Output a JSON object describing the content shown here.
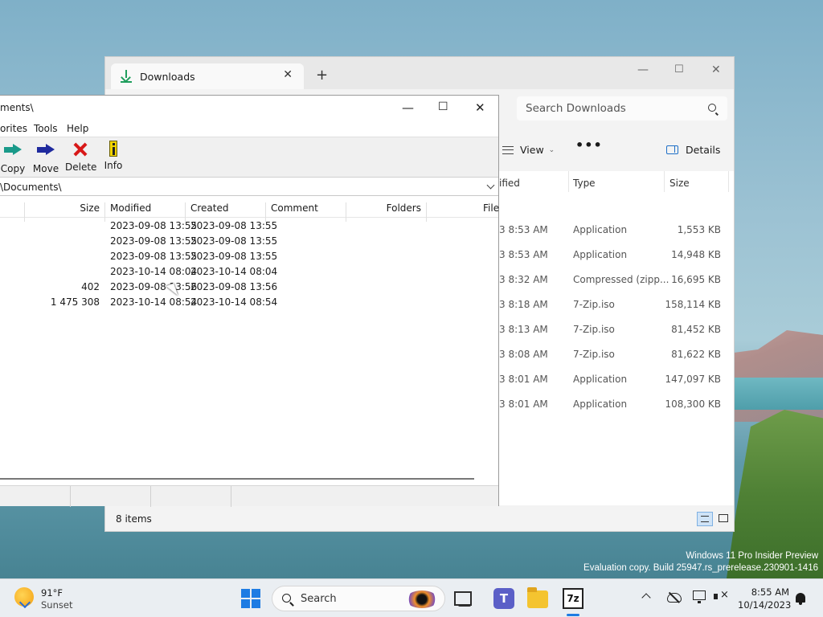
{
  "desktop": {
    "watermark_line1": "Windows 11 Pro Insider Preview",
    "watermark_line2": "Evaluation copy. Build 25947.rs_prerelease.230901-1416"
  },
  "explorer": {
    "tab_title": "Downloads",
    "search_placeholder": "Search Downloads",
    "view_label": "View",
    "more_label": "•••",
    "details_label": "Details",
    "columns": {
      "modified": "ified",
      "type": "Type",
      "size": "Size"
    },
    "rows": [
      {
        "modified": "3 8:53 AM",
        "type": "Application",
        "size": "1,553 KB"
      },
      {
        "modified": "3 8:53 AM",
        "type": "Application",
        "size": "14,948 KB"
      },
      {
        "modified": "3 8:32 AM",
        "type": "Compressed (zipp...",
        "size": "16,695 KB"
      },
      {
        "modified": "3 8:18 AM",
        "type": "7-Zip.iso",
        "size": "158,114 KB"
      },
      {
        "modified": "3 8:13 AM",
        "type": "7-Zip.iso",
        "size": "81,452 KB"
      },
      {
        "modified": "3 8:08 AM",
        "type": "7-Zip.iso",
        "size": "81,622 KB"
      },
      {
        "modified": "3 8:01 AM",
        "type": "Application",
        "size": "147,097 KB"
      },
      {
        "modified": "3 8:01 AM",
        "type": "Application",
        "size": "108,300 KB"
      }
    ],
    "item_count": "8 items"
  },
  "zip": {
    "title": "ments\\",
    "menu": [
      "orites",
      "Tools",
      "Help"
    ],
    "toolbar": {
      "copy": "Copy",
      "move": "Move",
      "delete": "Delete",
      "info": "Info"
    },
    "path": "\\Documents\\",
    "columns": {
      "size": "Size",
      "modified": "Modified",
      "created": "Created",
      "comment": "Comment",
      "folders": "Folders",
      "files": "File"
    },
    "rows": [
      {
        "size": "",
        "modified": "2023-09-08 13:55",
        "created": "2023-09-08 13:55"
      },
      {
        "size": "",
        "modified": "2023-09-08 13:55",
        "created": "2023-09-08 13:55"
      },
      {
        "size": "",
        "modified": "2023-09-08 13:55",
        "created": "2023-09-08 13:55"
      },
      {
        "size": "",
        "modified": "2023-10-14 08:04",
        "created": "2023-10-14 08:04"
      },
      {
        "size": "402",
        "modified": "2023-09-08 13:56",
        "created": "2023-09-08 13:56"
      },
      {
        "size": "1 475 308",
        "modified": "2023-10-14 08:54",
        "created": "2023-10-14 08:54"
      }
    ]
  },
  "taskbar": {
    "weather_temp": "91°F",
    "weather_desc": "Sunset",
    "search_label": "Search",
    "teams_letter": "T",
    "zip_letters": "7z",
    "time": "8:55 AM",
    "date": "10/14/2023"
  },
  "colors": {
    "accent": "#1e7ce3",
    "copy_arrow": "#1a9a8a",
    "move_arrow": "#1f2a9e",
    "delete_x": "#d81818"
  }
}
